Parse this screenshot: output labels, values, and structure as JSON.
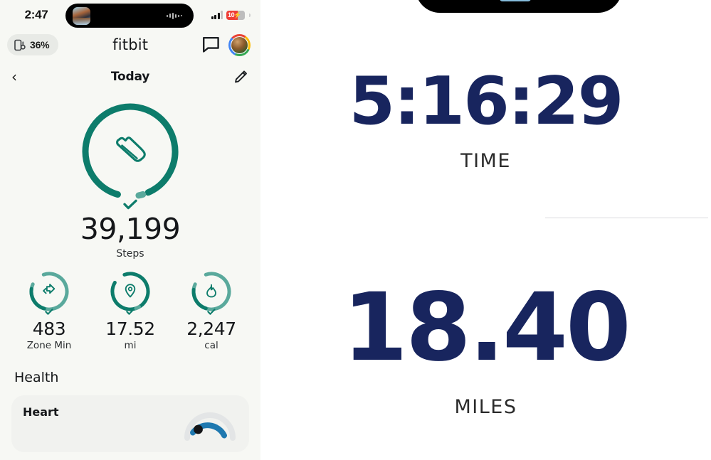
{
  "phone_status": {
    "time": "2:47",
    "battery_percent_badge": "10",
    "battery_charging_glyph": "⚡",
    "signal_icon": "cellular-signal-icon",
    "dynamic_island_icon": "dynamic-island"
  },
  "app": {
    "brand": "fitbit",
    "device_battery_chip": {
      "icon": "device-battery-icon",
      "label": "36%"
    },
    "messages_icon": "chat-bubble-icon",
    "avatar_icon": "profile-avatar",
    "sub_header": {
      "back_icon": "chevron-left-icon",
      "title": "Today",
      "edit_icon": "pencil-edit-icon"
    }
  },
  "steps": {
    "icon": "running-shoe-icon",
    "check_icon": "check-icon",
    "value": "39,199",
    "label": "Steps",
    "goal_met": true
  },
  "mini_stats": [
    {
      "icon": "zone-minutes-arrow-icon",
      "check_icon": "check-icon",
      "value": "483",
      "label": "Zone Min"
    },
    {
      "icon": "location-pin-icon",
      "check_icon": "check-icon",
      "value": "17.52",
      "label": "mi"
    },
    {
      "icon": "flame-icon",
      "check_icon": "check-icon",
      "value": "2,247",
      "label": "cal"
    }
  ],
  "health": {
    "section_title": "Health",
    "cards": [
      {
        "title": "Heart",
        "gauge_icon": "heart-rate-gauge-icon"
      }
    ]
  },
  "workout_summary": {
    "time": {
      "value": "5:16:29",
      "label": "TIME"
    },
    "distance": {
      "value": "18.40",
      "label": "MILES"
    }
  },
  "colors": {
    "teal": "#0d7c6b",
    "teal_light": "#5aa99c",
    "navy": "#18255e",
    "app_bg": "#f7f8f4",
    "card_bg": "#f1f2ef",
    "heart_blue": "#1f79b0",
    "battery_red": "#ef3e36"
  }
}
